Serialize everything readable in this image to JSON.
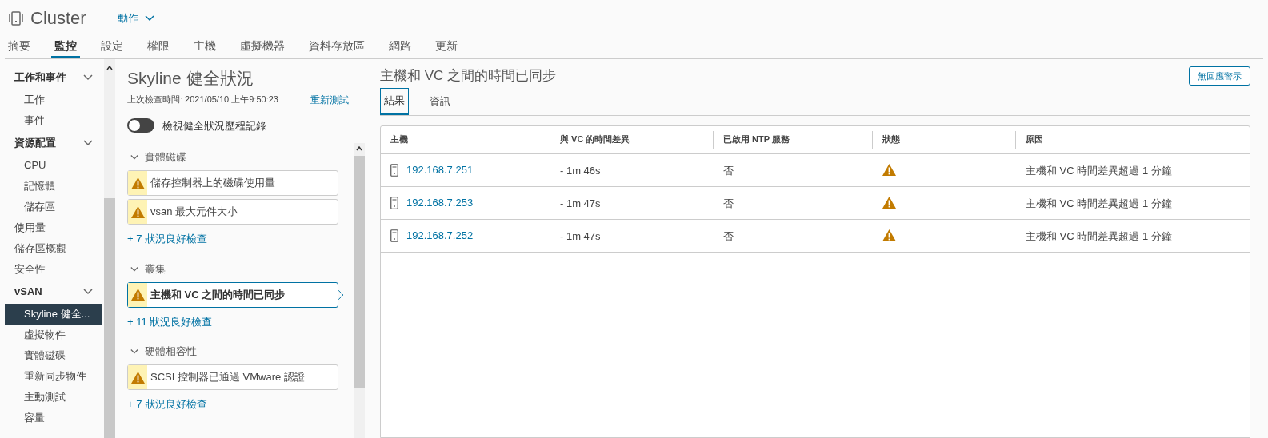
{
  "header": {
    "title": "Cluster",
    "actions_label": "動作"
  },
  "tabs": [
    {
      "label": "摘要",
      "selected": false
    },
    {
      "label": "監控",
      "selected": true
    },
    {
      "label": "設定",
      "selected": false
    },
    {
      "label": "權限",
      "selected": false
    },
    {
      "label": "主機",
      "selected": false
    },
    {
      "label": "虛擬機器",
      "selected": false
    },
    {
      "label": "資料存放區",
      "selected": false
    },
    {
      "label": "網路",
      "selected": false
    },
    {
      "label": "更新",
      "selected": false
    }
  ],
  "sidebar": {
    "items": [
      {
        "kind": "group",
        "label": "工作和事件",
        "expanded": true,
        "children": [
          {
            "label": "工作",
            "selected": false
          },
          {
            "label": "事件",
            "selected": false
          }
        ]
      },
      {
        "kind": "group",
        "label": "資源配置",
        "expanded": true,
        "children": [
          {
            "label": "CPU",
            "selected": false
          },
          {
            "label": "記憶體",
            "selected": false
          },
          {
            "label": "儲存區",
            "selected": false
          }
        ]
      },
      {
        "kind": "item",
        "label": "使用量",
        "selected": false
      },
      {
        "kind": "item",
        "label": "儲存區概觀",
        "selected": false
      },
      {
        "kind": "item",
        "label": "安全性",
        "selected": false
      },
      {
        "kind": "group",
        "label": "vSAN",
        "expanded": true,
        "children": [
          {
            "label": "Skyline 健全...",
            "selected": true
          },
          {
            "label": "虛擬物件",
            "selected": false
          },
          {
            "label": "實體磁碟",
            "selected": false
          },
          {
            "label": "重新同步物件",
            "selected": false
          },
          {
            "label": "主動測試",
            "selected": false
          },
          {
            "label": "容量",
            "selected": false
          }
        ]
      }
    ]
  },
  "health": {
    "title": "Skyline 健全狀況",
    "last_checked": "上次檢查時間: 2021/05/10 上午9:50:23",
    "retest": "重新測試",
    "history_toggle": {
      "label": "檢視健全狀況歷程記錄",
      "on": false
    },
    "categories": [
      {
        "label": "實體磁碟",
        "expanded": true,
        "checks": [
          {
            "label": "儲存控制器上的磁碟使用量",
            "selected": false
          },
          {
            "label": "vsan 最大元件大小",
            "selected": false
          }
        ],
        "more": "+ 7 狀況良好檢查"
      },
      {
        "label": "叢集",
        "expanded": true,
        "checks": [
          {
            "label": "主機和 VC 之間的時間已同步",
            "selected": true
          }
        ],
        "more": "+ 11 狀況良好檢查"
      },
      {
        "label": "硬體相容性",
        "expanded": true,
        "checks": [
          {
            "label": "SCSI 控制器已通過 VMware 認證",
            "selected": false
          }
        ],
        "more": "+ 7 狀況良好檢查"
      }
    ]
  },
  "detail": {
    "title": "主機和 VC 之間的時間已同步",
    "silence_button": "無回應警示",
    "tabs": [
      {
        "label": "結果",
        "selected": true
      },
      {
        "label": "資訊",
        "selected": false
      }
    ],
    "table": {
      "columns": [
        "主機",
        "與 VC 的時間差異",
        "已啟用 NTP 服務",
        "狀態",
        "原因"
      ],
      "rows": [
        {
          "host": "192.168.7.251",
          "time_diff": "- 1m 46s",
          "ntp": "否",
          "kind": "warning",
          "reason": "主機和 VC 時間差異超過 1 分鐘"
        },
        {
          "host": "192.168.7.253",
          "time_diff": "- 1m 47s",
          "ntp": "否",
          "kind": "warning",
          "reason": "主機和 VC 時間差異超過 1 分鐘"
        },
        {
          "host": "192.168.7.252",
          "time_diff": "- 1m 47s",
          "ntp": "否",
          "kind": "warning",
          "reason": "主機和 VC 時間差異超過 1 分鐘"
        }
      ]
    }
  }
}
